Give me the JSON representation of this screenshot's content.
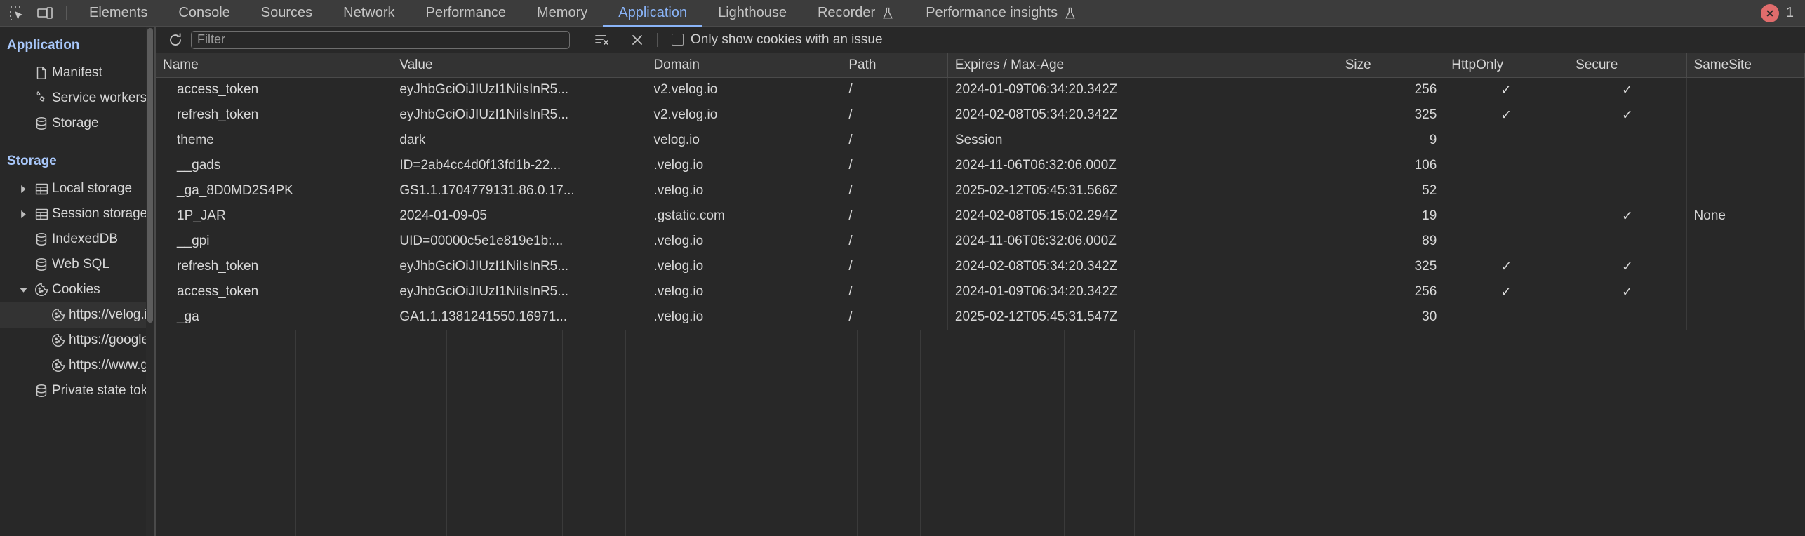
{
  "tabbar": {
    "inspect_icon": "inspect-element-icon",
    "device_icon": "device-toolbar-icon",
    "tabs": [
      {
        "label": "Elements",
        "active": false,
        "experimental": false
      },
      {
        "label": "Console",
        "active": false,
        "experimental": false
      },
      {
        "label": "Sources",
        "active": false,
        "experimental": false
      },
      {
        "label": "Network",
        "active": false,
        "experimental": false
      },
      {
        "label": "Performance",
        "active": false,
        "experimental": false
      },
      {
        "label": "Memory",
        "active": false,
        "experimental": false
      },
      {
        "label": "Application",
        "active": true,
        "experimental": false
      },
      {
        "label": "Lighthouse",
        "active": false,
        "experimental": false
      },
      {
        "label": "Recorder",
        "active": false,
        "experimental": true
      },
      {
        "label": "Performance insights",
        "active": false,
        "experimental": true
      }
    ],
    "error_count": "1",
    "error_color": "#e06c6c",
    "active_color": "#8ab4f8"
  },
  "sidebar": {
    "application_title": "Application",
    "application_items": [
      {
        "label": "Manifest",
        "icon": "document-icon"
      },
      {
        "label": "Service workers",
        "icon": "gears-icon"
      },
      {
        "label": "Storage",
        "icon": "database-icon"
      }
    ],
    "storage_title": "Storage",
    "storage_items": [
      {
        "label": "Local storage",
        "icon": "table-icon",
        "twisty": "collapsed",
        "indent": 1,
        "selected": false
      },
      {
        "label": "Session storage",
        "icon": "table-icon",
        "twisty": "collapsed",
        "indent": 1,
        "selected": false
      },
      {
        "label": "IndexedDB",
        "icon": "database-icon",
        "twisty": "none",
        "indent": 1,
        "selected": false
      },
      {
        "label": "Web SQL",
        "icon": "database-icon",
        "twisty": "none",
        "indent": 1,
        "selected": false
      },
      {
        "label": "Cookies",
        "icon": "cookie-icon",
        "twisty": "expanded",
        "indent": 1,
        "selected": false
      },
      {
        "label": "https://velog.io",
        "icon": "cookie-icon",
        "twisty": "none",
        "indent": 2,
        "selected": true
      },
      {
        "label": "https://googleads.g.",
        "icon": "cookie-icon",
        "twisty": "none",
        "indent": 2,
        "selected": false
      },
      {
        "label": "https://www.google",
        "icon": "cookie-icon",
        "twisty": "none",
        "indent": 2,
        "selected": false
      },
      {
        "label": "Private state tokens",
        "icon": "database-icon",
        "twisty": "none",
        "indent": 1,
        "selected": false
      }
    ]
  },
  "toolbar": {
    "refresh_icon": "refresh-icon",
    "filter_placeholder": "Filter",
    "filter_value": "",
    "clear_filtered_icon": "clear-filtered-icon",
    "clear_all_icon": "clear-all-icon",
    "only_issue_label": "Only show cookies with an issue",
    "only_issue_checked": false
  },
  "table": {
    "columns": [
      "Name",
      "Value",
      "Domain",
      "Path",
      "Expires / Max-Age",
      "Size",
      "HttpOnly",
      "Secure",
      "SameSite"
    ],
    "rows": [
      {
        "name": "access_token",
        "value": "eyJhbGciOiJIUzI1NiIsInR5...",
        "domain": "v2.velog.io",
        "path": "/",
        "expires": "2024-01-09T06:34:20.342Z",
        "size": "256",
        "httponly": "✓",
        "secure": "✓",
        "samesite": ""
      },
      {
        "name": "refresh_token",
        "value": "eyJhbGciOiJIUzI1NiIsInR5...",
        "domain": "v2.velog.io",
        "path": "/",
        "expires": "2024-02-08T05:34:20.342Z",
        "size": "325",
        "httponly": "✓",
        "secure": "✓",
        "samesite": ""
      },
      {
        "name": "theme",
        "value": "dark",
        "domain": "velog.io",
        "path": "/",
        "expires": "Session",
        "size": "9",
        "httponly": "",
        "secure": "",
        "samesite": ""
      },
      {
        "name": "__gads",
        "value": "ID=2ab4cc4d0f13fd1b-22...",
        "domain": ".velog.io",
        "path": "/",
        "expires": "2024-11-06T06:32:06.000Z",
        "size": "106",
        "httponly": "",
        "secure": "",
        "samesite": ""
      },
      {
        "name": "_ga_8D0MD2S4PK",
        "value": "GS1.1.1704779131.86.0.17...",
        "domain": ".velog.io",
        "path": "/",
        "expires": "2025-02-12T05:45:31.566Z",
        "size": "52",
        "httponly": "",
        "secure": "",
        "samesite": ""
      },
      {
        "name": "1P_JAR",
        "value": "2024-01-09-05",
        "domain": ".gstatic.com",
        "path": "/",
        "expires": "2024-02-08T05:15:02.294Z",
        "size": "19",
        "httponly": "",
        "secure": "✓",
        "samesite": "None"
      },
      {
        "name": "__gpi",
        "value": "UID=00000c5e1e819e1b:...",
        "domain": ".velog.io",
        "path": "/",
        "expires": "2024-11-06T06:32:06.000Z",
        "size": "89",
        "httponly": "",
        "secure": "",
        "samesite": ""
      },
      {
        "name": "refresh_token",
        "value": "eyJhbGciOiJIUzI1NiIsInR5...",
        "domain": ".velog.io",
        "path": "/",
        "expires": "2024-02-08T05:34:20.342Z",
        "size": "325",
        "httponly": "✓",
        "secure": "✓",
        "samesite": ""
      },
      {
        "name": "access_token",
        "value": "eyJhbGciOiJIUzI1NiIsInR5...",
        "domain": ".velog.io",
        "path": "/",
        "expires": "2024-01-09T06:34:20.342Z",
        "size": "256",
        "httponly": "✓",
        "secure": "✓",
        "samesite": ""
      },
      {
        "name": "_ga",
        "value": "GA1.1.1381241550.16971...",
        "domain": ".velog.io",
        "path": "/",
        "expires": "2025-02-12T05:45:31.547Z",
        "size": "30",
        "httponly": "",
        "secure": "",
        "samesite": ""
      }
    ]
  }
}
